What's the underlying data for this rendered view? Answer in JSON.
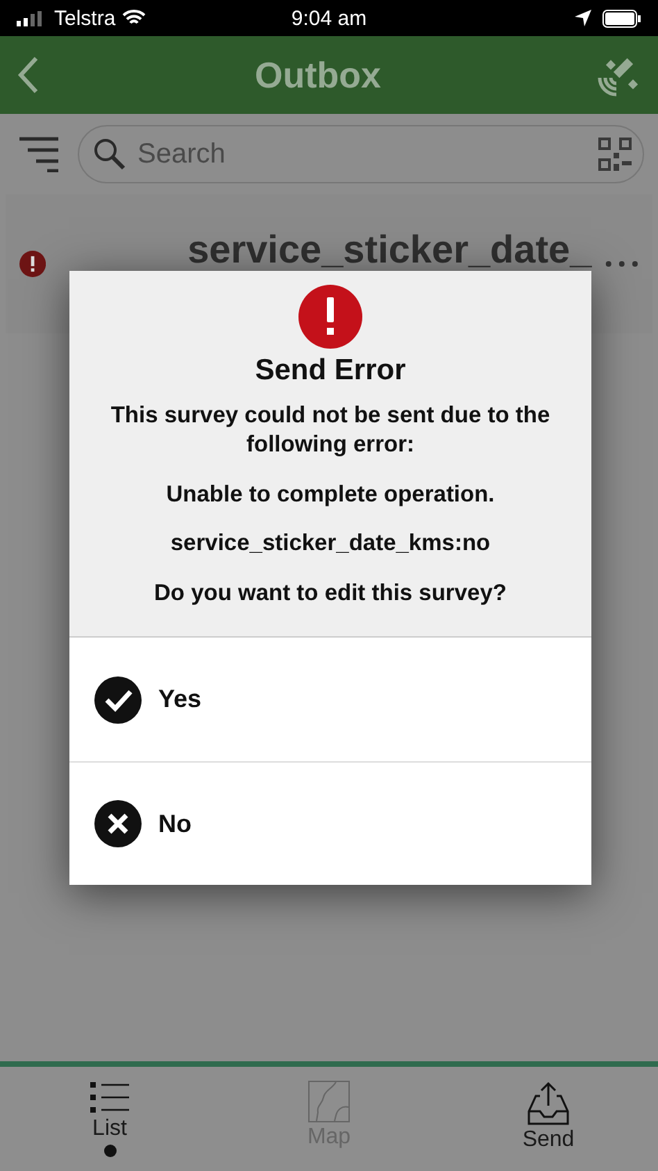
{
  "status_bar": {
    "carrier": "Telstra",
    "time": "9:04 am"
  },
  "header": {
    "title": "Outbox"
  },
  "search": {
    "placeholder": "Search"
  },
  "list_item": {
    "title": "service_sticker_date_"
  },
  "dialog": {
    "title": "Send Error",
    "messages": [
      "This survey could not be sent due to the following error:",
      "Unable to complete operation.",
      "service_sticker_date_kms:no",
      "Do you want to edit this survey?"
    ],
    "options": [
      {
        "label": "Yes",
        "kind": "check"
      },
      {
        "label": "No",
        "kind": "cross"
      }
    ]
  },
  "tabs": [
    {
      "label": "List",
      "kind": "list",
      "selected": true,
      "disabled": false
    },
    {
      "label": "Map",
      "kind": "map",
      "selected": false,
      "disabled": true
    },
    {
      "label": "Send",
      "kind": "send",
      "selected": false,
      "disabled": false
    }
  ]
}
